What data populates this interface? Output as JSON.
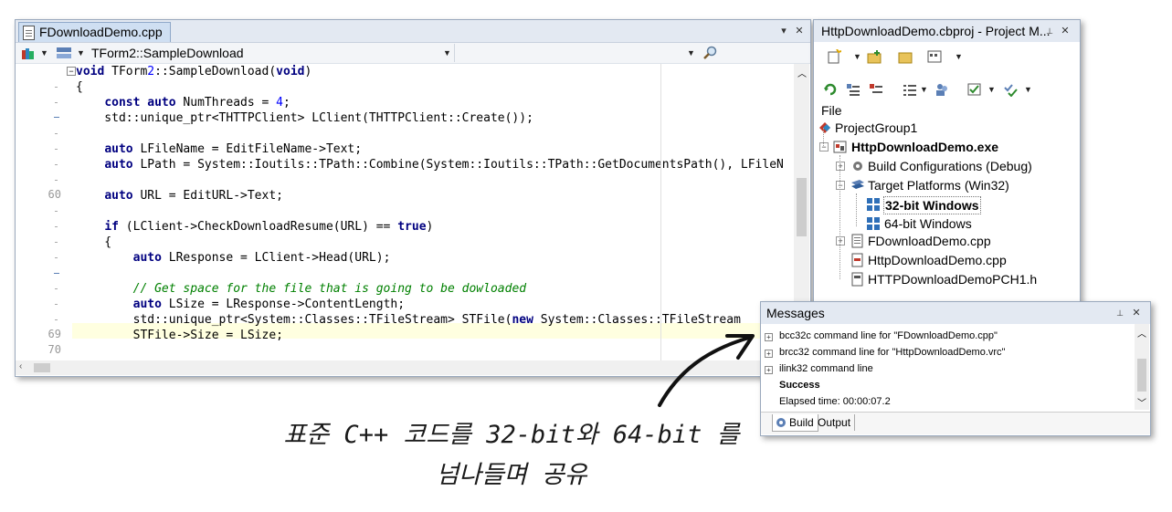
{
  "editor": {
    "tab_title": "FDownloadDemo.cpp",
    "function_combo": "TForm2::SampleDownload",
    "pin_glyph": "▾",
    "close_glyph": "✕",
    "gutter": {
      "line_60": "60",
      "line_69": "69",
      "line_70": "70"
    },
    "code": [
      "void TForm2::SampleDownload(void)",
      "{",
      "    const auto NumThreads = 4;",
      "    std::unique_ptr<THTTPClient> LClient(THTTPClient::Create());",
      "",
      "    auto LFileName = EditFileName->Text;",
      "    auto LPath = System::Ioutils::TPath::Combine(System::Ioutils::TPath::GetDocumentsPath(), LFileN",
      "",
      "    auto URL = EditURL->Text;",
      "",
      "    if (LClient->CheckDownloadResume(URL) == true)",
      "    {",
      "        auto LResponse = LClient->Head(URL);",
      "",
      "        // Get space for the file that is going to be dowloaded",
      "        auto LSize = LResponse->ContentLength;",
      "        std::unique_ptr<System::Classes::TFileStream> STFile(new System::Classes::TFileStream",
      "        STFile->Size = LSize;",
      ""
    ]
  },
  "project_manager": {
    "title": "HttpDownloadDemo.cbproj - Project M...",
    "pin_glyph": "📌",
    "close_glyph": "✕",
    "section_label": "File",
    "tree": {
      "group": "ProjectGroup1",
      "project": "HttpDownloadDemo.exe",
      "build_configs": "Build Configurations (Debug)",
      "target_platforms": "Target Platforms (Win32)",
      "win32": "32-bit Windows",
      "win64": "64-bit Windows",
      "file1": "FDownloadDemo.cpp",
      "file2": "HttpDownloadDemo.cpp",
      "file3": "HTTPDownloadDemoPCH1.h"
    }
  },
  "messages": {
    "title": "Messages",
    "rows": {
      "r1": "bcc32c command line for \"FDownloadDemo.cpp\"",
      "r2": "brcc32 command line for \"HttpDownloadDemo.vrc\"",
      "r3": "ilink32 command line",
      "r4": "Success",
      "r5": "Elapsed time: 00:00:07.2"
    },
    "tabs": {
      "build": "Build",
      "output": "Output"
    }
  },
  "annotation": {
    "line1": "표준 C++ 코드를 32-bit와 64-bit 를",
    "line2": "넘나들며 공유"
  },
  "colors": {
    "keyword": "#000080",
    "number": "#0000ff",
    "comment": "#008000",
    "panel_header": "#e3e9f2",
    "highlight_line": "#ffffe0"
  }
}
